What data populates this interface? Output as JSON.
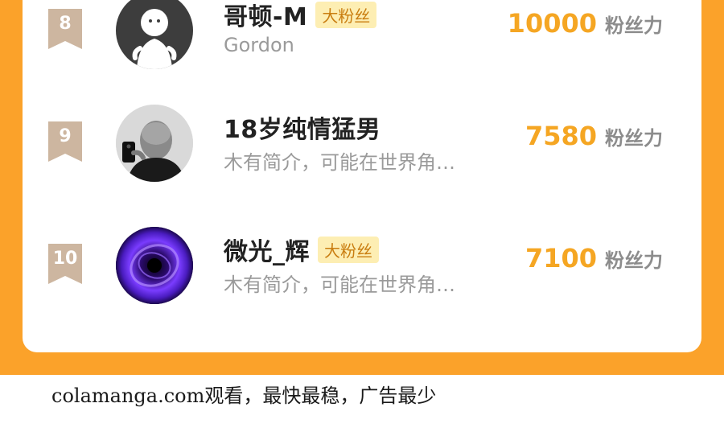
{
  "ranking": {
    "rows": [
      {
        "rank": "8",
        "name": "哥顿-M",
        "badge": "大粉丝",
        "subtitle": "Gordon",
        "fans": "10000",
        "fans_unit": "粉丝力",
        "avatar_icon": "ghost-avatar"
      },
      {
        "rank": "9",
        "name": "18岁纯情猛男",
        "badge": "",
        "subtitle": "木有简介，可能在世界角…",
        "fans": "7580",
        "fans_unit": "粉丝力",
        "avatar_icon": "selfie-photo-avatar"
      },
      {
        "rank": "10",
        "name": "微光_辉",
        "badge": "大粉丝",
        "subtitle": "木有简介，可能在世界角…",
        "fans": "7100",
        "fans_unit": "粉丝力",
        "avatar_icon": "purple-vortex-avatar"
      }
    ]
  },
  "footer": {
    "text": "colamanga.com观看，最快最稳，广告最少"
  },
  "colors": {
    "frame": "#fba22a",
    "fans_number": "#f5a623",
    "rank_badge": "#cdb6a0",
    "fan_badge_bg": "#fdeeb3"
  }
}
